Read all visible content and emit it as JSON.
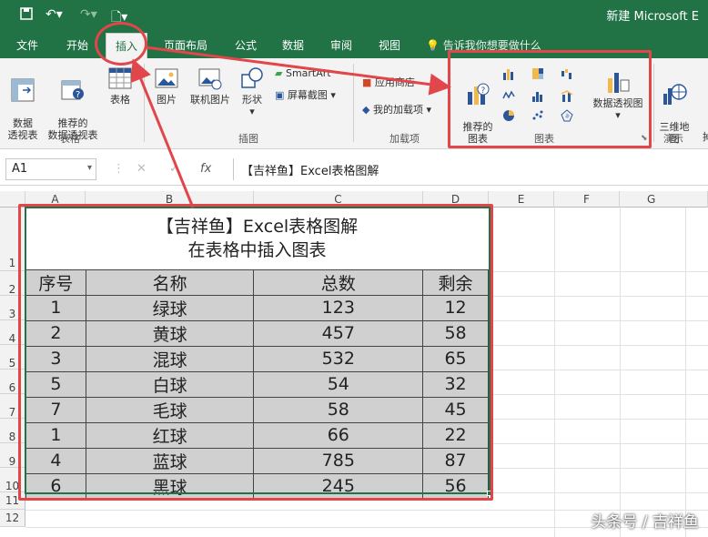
{
  "titlebar": {
    "title": "新建 Microsoft E"
  },
  "tabs": [
    "文件",
    "开始",
    "插入",
    "页面布局",
    "公式",
    "数据",
    "审阅",
    "视图"
  ],
  "tell_me": "告诉我你想要做什么",
  "ribbon": {
    "pivot_table": "数据\n透视表",
    "recommended_pivot": "推荐的\n数据透视表",
    "table": "表格",
    "group_tables": "表格",
    "picture": "图片",
    "online_picture": "联机图片",
    "shapes": "形状",
    "smartart": "SmartArt",
    "screenshot": "屏幕截图",
    "group_illustrations": "插图",
    "store": "应用商店",
    "my_addins": "我的加载项",
    "group_addins": "加载项",
    "recommended_charts": "推荐的\n图表",
    "pivot_chart": "数据透视图",
    "group_charts": "图表",
    "map3d": "三维地\n图",
    "group_tours": "演示"
  },
  "formula_bar": {
    "name_box": "A1",
    "fx": "fx",
    "content": "【吉祥鱼】Excel表格图解"
  },
  "columns": [
    "A",
    "B",
    "C",
    "D",
    "E",
    "F",
    "G"
  ],
  "rows": [
    "1",
    "2",
    "3",
    "4",
    "5",
    "6",
    "7",
    "8",
    "9",
    "10",
    "11",
    "12"
  ],
  "sheet": {
    "title_line1": "【吉祥鱼】Excel表格图解",
    "title_line2": "在表格中插入图表",
    "headers": [
      "序号",
      "名称",
      "总数",
      "剩余"
    ],
    "data": [
      [
        "1",
        "绿球",
        "123",
        "12"
      ],
      [
        "2",
        "黄球",
        "457",
        "58"
      ],
      [
        "3",
        "混球",
        "532",
        "65"
      ],
      [
        "5",
        "白球",
        "54",
        "32"
      ],
      [
        "7",
        "毛球",
        "58",
        "45"
      ],
      [
        "1",
        "红球",
        "66",
        "22"
      ],
      [
        "4",
        "蓝球",
        "785",
        "87"
      ],
      [
        "6",
        "黑球",
        "245",
        "56"
      ]
    ]
  },
  "watermark": "头条号 / 吉祥鱼",
  "colors": {
    "excel_green": "#217346",
    "highlight_red": "#e0464a"
  }
}
